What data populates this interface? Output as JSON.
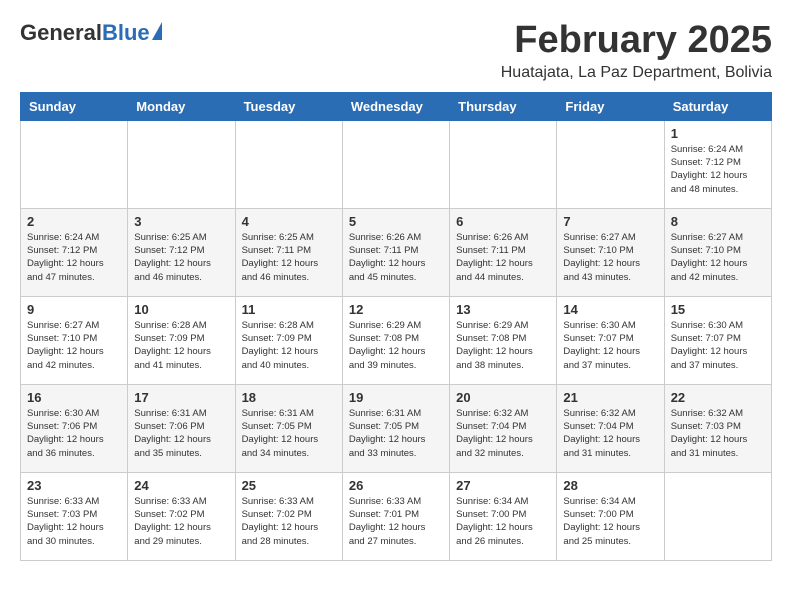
{
  "header": {
    "logo_general": "General",
    "logo_blue": "Blue",
    "month_title": "February 2025",
    "subtitle": "Huatajata, La Paz Department, Bolivia"
  },
  "weekdays": [
    "Sunday",
    "Monday",
    "Tuesday",
    "Wednesday",
    "Thursday",
    "Friday",
    "Saturday"
  ],
  "weeks": [
    [
      {
        "day": "",
        "info": ""
      },
      {
        "day": "",
        "info": ""
      },
      {
        "day": "",
        "info": ""
      },
      {
        "day": "",
        "info": ""
      },
      {
        "day": "",
        "info": ""
      },
      {
        "day": "",
        "info": ""
      },
      {
        "day": "1",
        "info": "Sunrise: 6:24 AM\nSunset: 7:12 PM\nDaylight: 12 hours\nand 48 minutes."
      }
    ],
    [
      {
        "day": "2",
        "info": "Sunrise: 6:24 AM\nSunset: 7:12 PM\nDaylight: 12 hours\nand 47 minutes."
      },
      {
        "day": "3",
        "info": "Sunrise: 6:25 AM\nSunset: 7:12 PM\nDaylight: 12 hours\nand 46 minutes."
      },
      {
        "day": "4",
        "info": "Sunrise: 6:25 AM\nSunset: 7:11 PM\nDaylight: 12 hours\nand 46 minutes."
      },
      {
        "day": "5",
        "info": "Sunrise: 6:26 AM\nSunset: 7:11 PM\nDaylight: 12 hours\nand 45 minutes."
      },
      {
        "day": "6",
        "info": "Sunrise: 6:26 AM\nSunset: 7:11 PM\nDaylight: 12 hours\nand 44 minutes."
      },
      {
        "day": "7",
        "info": "Sunrise: 6:27 AM\nSunset: 7:10 PM\nDaylight: 12 hours\nand 43 minutes."
      },
      {
        "day": "8",
        "info": "Sunrise: 6:27 AM\nSunset: 7:10 PM\nDaylight: 12 hours\nand 42 minutes."
      }
    ],
    [
      {
        "day": "9",
        "info": "Sunrise: 6:27 AM\nSunset: 7:10 PM\nDaylight: 12 hours\nand 42 minutes."
      },
      {
        "day": "10",
        "info": "Sunrise: 6:28 AM\nSunset: 7:09 PM\nDaylight: 12 hours\nand 41 minutes."
      },
      {
        "day": "11",
        "info": "Sunrise: 6:28 AM\nSunset: 7:09 PM\nDaylight: 12 hours\nand 40 minutes."
      },
      {
        "day": "12",
        "info": "Sunrise: 6:29 AM\nSunset: 7:08 PM\nDaylight: 12 hours\nand 39 minutes."
      },
      {
        "day": "13",
        "info": "Sunrise: 6:29 AM\nSunset: 7:08 PM\nDaylight: 12 hours\nand 38 minutes."
      },
      {
        "day": "14",
        "info": "Sunrise: 6:30 AM\nSunset: 7:07 PM\nDaylight: 12 hours\nand 37 minutes."
      },
      {
        "day": "15",
        "info": "Sunrise: 6:30 AM\nSunset: 7:07 PM\nDaylight: 12 hours\nand 37 minutes."
      }
    ],
    [
      {
        "day": "16",
        "info": "Sunrise: 6:30 AM\nSunset: 7:06 PM\nDaylight: 12 hours\nand 36 minutes."
      },
      {
        "day": "17",
        "info": "Sunrise: 6:31 AM\nSunset: 7:06 PM\nDaylight: 12 hours\nand 35 minutes."
      },
      {
        "day": "18",
        "info": "Sunrise: 6:31 AM\nSunset: 7:05 PM\nDaylight: 12 hours\nand 34 minutes."
      },
      {
        "day": "19",
        "info": "Sunrise: 6:31 AM\nSunset: 7:05 PM\nDaylight: 12 hours\nand 33 minutes."
      },
      {
        "day": "20",
        "info": "Sunrise: 6:32 AM\nSunset: 7:04 PM\nDaylight: 12 hours\nand 32 minutes."
      },
      {
        "day": "21",
        "info": "Sunrise: 6:32 AM\nSunset: 7:04 PM\nDaylight: 12 hours\nand 31 minutes."
      },
      {
        "day": "22",
        "info": "Sunrise: 6:32 AM\nSunset: 7:03 PM\nDaylight: 12 hours\nand 31 minutes."
      }
    ],
    [
      {
        "day": "23",
        "info": "Sunrise: 6:33 AM\nSunset: 7:03 PM\nDaylight: 12 hours\nand 30 minutes."
      },
      {
        "day": "24",
        "info": "Sunrise: 6:33 AM\nSunset: 7:02 PM\nDaylight: 12 hours\nand 29 minutes."
      },
      {
        "day": "25",
        "info": "Sunrise: 6:33 AM\nSunset: 7:02 PM\nDaylight: 12 hours\nand 28 minutes."
      },
      {
        "day": "26",
        "info": "Sunrise: 6:33 AM\nSunset: 7:01 PM\nDaylight: 12 hours\nand 27 minutes."
      },
      {
        "day": "27",
        "info": "Sunrise: 6:34 AM\nSunset: 7:00 PM\nDaylight: 12 hours\nand 26 minutes."
      },
      {
        "day": "28",
        "info": "Sunrise: 6:34 AM\nSunset: 7:00 PM\nDaylight: 12 hours\nand 25 minutes."
      },
      {
        "day": "",
        "info": ""
      }
    ]
  ]
}
